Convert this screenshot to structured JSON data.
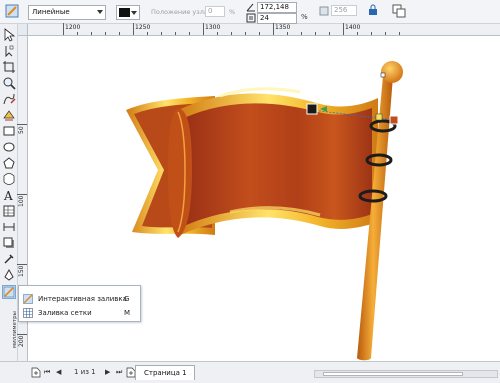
{
  "propbar": {
    "fill_type": "Линейные",
    "node_position_label": "Положение узла:",
    "node_position_value": "0",
    "node_position_unit": "%",
    "angle_value": "172,148",
    "edge_pad_value": "24",
    "edge_pad_unit": "%",
    "steps_value": "256"
  },
  "ruler_top": {
    "labels": [
      "1200",
      "1250",
      "1300",
      "1350",
      "1400"
    ]
  },
  "ruler_left": {
    "labels": [
      "50",
      "100",
      "150",
      "200"
    ],
    "unit": "миллиметры"
  },
  "flyout": {
    "items": [
      {
        "label": "Интерактивная заливка",
        "shortcut": "G",
        "icon": "interactive-fill-icon"
      },
      {
        "label": "Заливка сетки",
        "shortcut": "M",
        "icon": "mesh-fill-icon"
      }
    ]
  },
  "pagebar": {
    "page_counter": "1 из 1",
    "page_tab": "Страница 1"
  },
  "colors": {
    "flag_dark": "#a8361a",
    "flag_mid": "#c7561d",
    "flag_gold": "#f2b62b",
    "pole": "#e08a1c",
    "active_tool_bg": "#d6e8f7"
  }
}
